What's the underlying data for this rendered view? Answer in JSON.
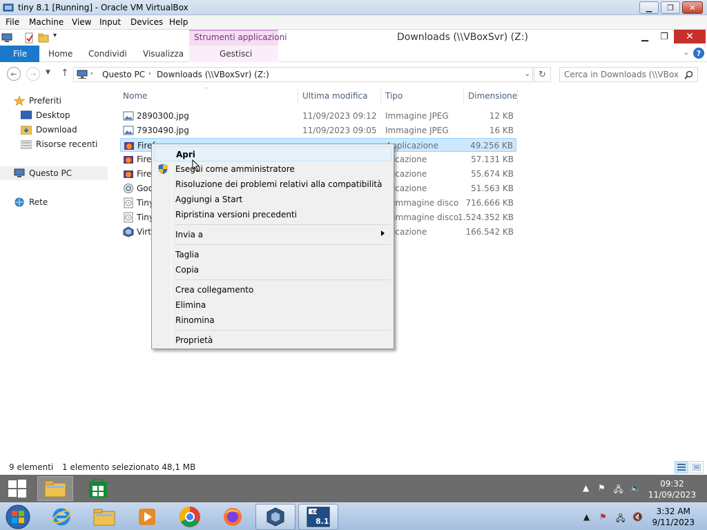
{
  "host_window": {
    "title": "tiny 8.1 [Running] - Oracle VM VirtualBox",
    "menu": [
      "File",
      "Machine",
      "View",
      "Input",
      "Devices",
      "Help"
    ]
  },
  "explorer": {
    "title": "Downloads (\\\\VBoxSvr) (Z:)",
    "tools_tab": "Strumenti applicazioni",
    "ribbon_tabs": {
      "file": "File",
      "home": "Home",
      "share": "Condividi",
      "view": "Visualizza",
      "manage": "Gestisci"
    },
    "address": {
      "crumb1": "Questo PC",
      "crumb2": "Downloads (\\\\VBoxSvr) (Z:)"
    },
    "search": {
      "placeholder": "Cerca in Downloads (\\\\VBoxS..."
    },
    "nav": {
      "favorites": "Preferiti",
      "desktop": "Desktop",
      "download": "Download",
      "recent": "Risorse recenti",
      "this_pc": "Questo PC",
      "network": "Rete"
    },
    "columns": {
      "name": "Nome",
      "modified": "Ultima modifica",
      "type": "Tipo",
      "size": "Dimensione"
    },
    "files": [
      {
        "name": "2890300.jpg",
        "modified": "11/09/2023 09:12",
        "type": "Immagine JPEG",
        "size": "12 KB"
      },
      {
        "name": "7930490.jpg",
        "modified": "11/09/2023 09:05",
        "type": "Immagine JPEG",
        "size": "16 KB"
      },
      {
        "name": "Firef",
        "modified": "",
        "type": "Applicazione",
        "size": "49.256 KB"
      },
      {
        "name": "Firef",
        "modified": "",
        "type": "plicazione",
        "size": "57.131 KB"
      },
      {
        "name": "Firef",
        "modified": "",
        "type": "plicazione",
        "size": "55.674 KB"
      },
      {
        "name": "Goo",
        "modified": "",
        "type": "plicazione",
        "size": "51.563 KB"
      },
      {
        "name": "Tiny",
        "modified": "",
        "type": "e immagine disco",
        "size": "716.666 KB"
      },
      {
        "name": "Tiny",
        "modified": "",
        "type": "e immagine disco",
        "size": "1.524.352 KB"
      },
      {
        "name": "Virtu",
        "modified": "",
        "type": "plicazione",
        "size": "166.542 KB"
      }
    ],
    "status": {
      "count": "9 elementi",
      "selection": "1 elemento selezionato  48,1 MB"
    }
  },
  "context_menu": {
    "open": "Apri",
    "run_as_admin": "Esegui come amministratore",
    "troubleshoot": "Risoluzione dei problemi relativi alla compatibilità",
    "pin_start": "Aggiungi a Start",
    "restore": "Ripristina versioni precedenti",
    "send_to": "Invia a",
    "cut": "Taglia",
    "copy": "Copia",
    "create_shortcut": "Crea collegamento",
    "delete": "Elimina",
    "rename": "Rinomina",
    "properties": "Proprietà"
  },
  "guest_taskbar": {
    "time": "09:32",
    "date": "11/09/2023"
  },
  "host_taskbar": {
    "time": "3:32 AM",
    "date": "9/11/2023"
  },
  "colors": {
    "selection": "#cce8ff",
    "file_tab": "#1979ca",
    "tools_tab": "#f6dcf2"
  }
}
